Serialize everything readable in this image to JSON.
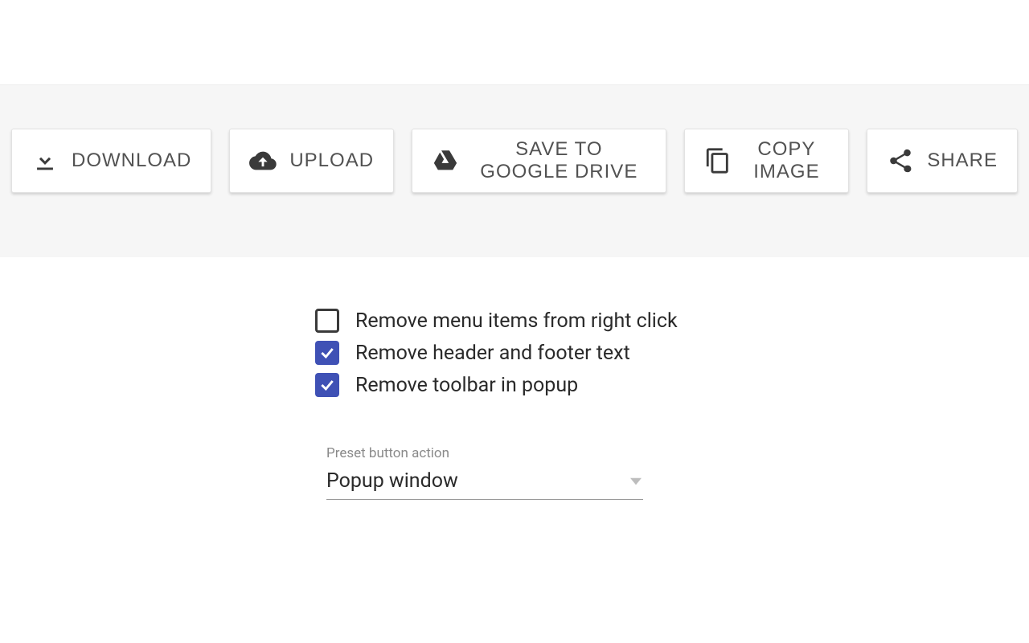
{
  "toolbar": {
    "download": "DOWNLOAD",
    "upload": "UPLOAD",
    "save_drive": "SAVE TO GOOGLE DRIVE",
    "copy_image": "COPY IMAGE",
    "share": "SHARE"
  },
  "options": {
    "remove_menu": {
      "label": "Remove menu items from right click",
      "checked": false
    },
    "remove_header_footer": {
      "label": "Remove header and footer text",
      "checked": true
    },
    "remove_toolbar_popup": {
      "label": "Remove toolbar in popup",
      "checked": true
    }
  },
  "preset": {
    "caption": "Preset button action",
    "value": "Popup window"
  }
}
